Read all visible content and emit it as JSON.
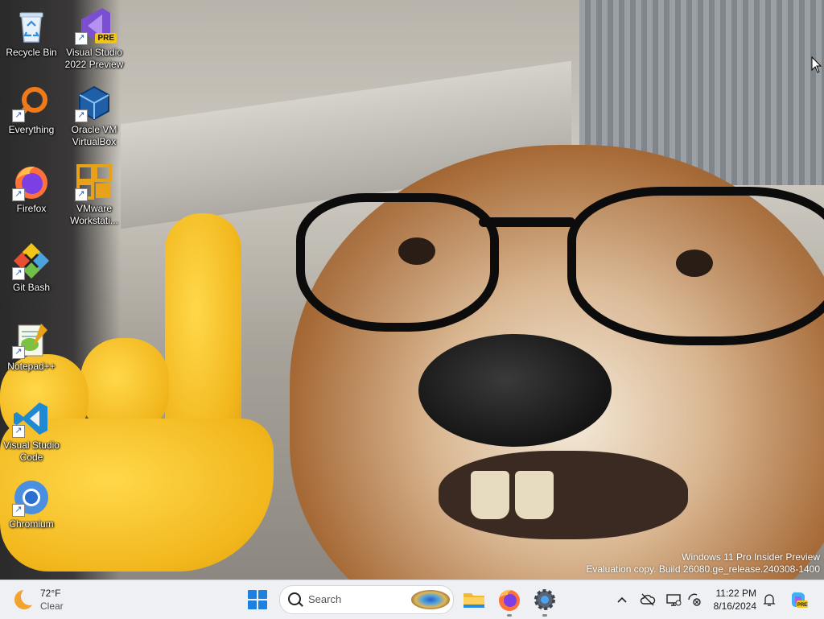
{
  "desktop": {
    "icons": [
      {
        "label": "Recycle Bin",
        "icon": "recycle-bin-icon",
        "shortcut": false
      },
      {
        "label": "Visual Studio 2022 Preview",
        "icon": "visual-studio-preview-icon",
        "badge": "PRE",
        "shortcut": true
      },
      {
        "label": "Everything",
        "icon": "everything-search-icon",
        "shortcut": true
      },
      {
        "label": "Oracle VM VirtualBox",
        "icon": "virtualbox-icon",
        "shortcut": true
      },
      {
        "label": "Firefox",
        "icon": "firefox-icon",
        "shortcut": true
      },
      {
        "label": "VMware Workstati...",
        "icon": "vmware-workstation-icon",
        "shortcut": true
      },
      {
        "label": "Git Bash",
        "icon": "git-bash-icon",
        "shortcut": true
      },
      {
        "label": "Notepad++",
        "icon": "notepad-plus-plus-icon",
        "shortcut": true
      },
      {
        "label": "Visual Studio Code",
        "icon": "vscode-icon",
        "shortcut": true
      },
      {
        "label": "Chromium",
        "icon": "chromium-icon",
        "shortcut": true
      }
    ],
    "shortcut_arrow": "↗",
    "watermark": {
      "line1": "Windows 11 Pro Insider Preview",
      "line2": "Evaluation copy. Build 26080.ge_release.240308-1400"
    },
    "wallpaper": "corgi-with-glasses-and-pointing-hand"
  },
  "taskbar": {
    "weather": {
      "temp": "72°F",
      "condition": "Clear",
      "icon": "moon-icon"
    },
    "search_placeholder": "Search",
    "apps": [
      "start-icon",
      "search-box",
      "file-explorer-icon",
      "firefox-icon",
      "settings-icon"
    ],
    "tray": {
      "icons": [
        "chevron-up-icon",
        "cloud-off-icon",
        "display-icon",
        "network-icon",
        "notification-bell-icon",
        "copilot-icon"
      ],
      "time": "11:22 PM",
      "date": "8/16/2024"
    }
  },
  "colors": {
    "accent": "#1d7fe0",
    "taskbar_bg": "#eef0f3"
  }
}
